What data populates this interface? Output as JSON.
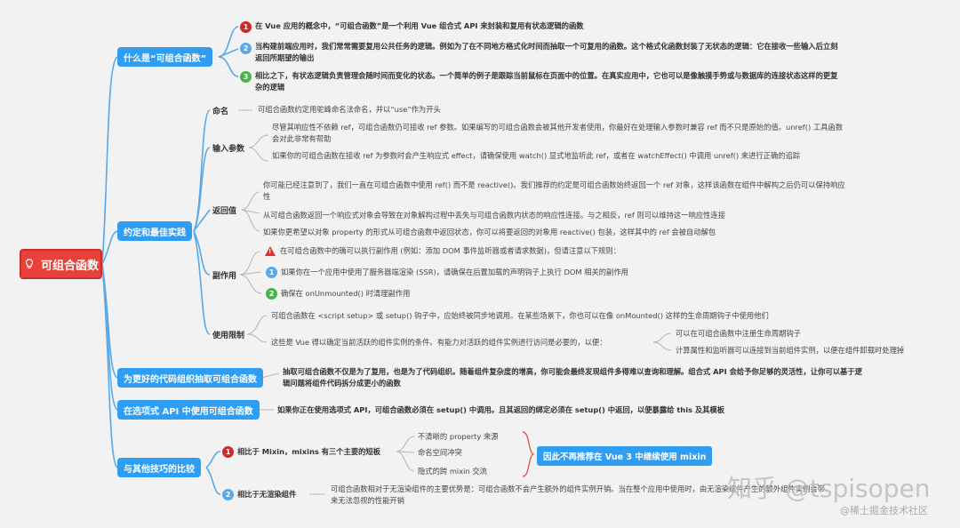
{
  "root": {
    "label": "可组合函数",
    "icon": "lightbulb-icon"
  },
  "branches": {
    "what": {
      "label": "什么是“可组合函数”",
      "items": [
        {
          "num": "1",
          "text": "在 Vue 应用的概念中，“可组合函数”是一个利用 Vue 组合式 API 来封装和复用有状态逻辑的函数"
        },
        {
          "num": "2",
          "text": "当构建前端应用时，我们常常需要复用公共任务的逻辑。例如为了在不同地方格式化时间而抽取一个可复用的函数。这个格式化函数封装了无状态的逻辑：它在接收一些输入后立刻返回所期望的输出"
        },
        {
          "num": "3",
          "text": "相比之下，有状态逻辑负责管理会随时间而变化的状态。一个简单的例子是跟踪当前鼠标在页面中的位置。在真实应用中，它也可以是像触摸手势或与数据库的连接状态这样的更复杂的逻辑"
        }
      ]
    },
    "conventions": {
      "label": "约定和最佳实践",
      "naming": {
        "label": "命名",
        "text": "可组合函数约定用驼峰命名法命名，并以“use”作为开头"
      },
      "input": {
        "label": "输入参数",
        "items": [
          "尽管其响应性不依赖 ref，可组合函数仍可接收 ref 参数。如果编写的可组合函数会被其他开发者使用，你最好在处理输入参数时兼容 ref 而不只是原始的值。unref() 工具函数会对此非常有帮助",
          "如果你的可组合函数在接收 ref 为参数时会产生响应式 effect，请确保使用 watch() 显式地监听此 ref，或者在 watchEffect() 中调用 unref() 来进行正确的追踪"
        ]
      },
      "return": {
        "label": "返回值",
        "items": [
          "你可能已经注意到了，我们一直在可组合函数中使用 ref() 而不是 reactive()。我们推荐的约定是可组合函数始终返回一个 ref 对象，这样该函数在组件中解构之后仍可以保持响应性",
          "从可组合函数返回一个响应式对象会导致在对象解构过程中丢失与可组合函数内状态的响应性连接。与之相反，ref 则可以维持这一响应性连接",
          "如果你更希望以对象 property 的形式从可组合函数中返回状态，你可以将要返回的对象用 reactive() 包装，这样其中的 ref 会被自动解包"
        ]
      },
      "side_effects": {
        "label": "副作用",
        "warning": "在可组合函数中的确可以执行副作用 (例如：添加 DOM 事件监听器或者请求数据)，但请注意以下规则：",
        "items": [
          {
            "num": "1",
            "text": "如果你在一个应用中使用了服务器端渲染 (SSR)，请确保在后置加载的声明钩子上执行 DOM 相关的副作用"
          },
          {
            "num": "2",
            "text": "确保在 onUnmounted() 时清理副作用"
          }
        ]
      },
      "limits": {
        "label": "使用限制",
        "items": [
          "可组合函数在 <script setup> 或 setup() 钩子中，应始终被同步地调用。在某些场景下，你也可以在像 onMounted() 这样的生命周期钩子中使用他们",
          "这些是 Vue 得以确定当前活跃的组件实例的条件。有能力对活跃的组件实例进行访问是必要的，以便："
        ],
        "sub": [
          "可以在可组合函数中注册生命周期钩子",
          "计算属性和监听器可以连接到当前组件实例，以便在组件卸载时处理掉"
        ]
      }
    },
    "extract": {
      "label": "为更好的代码组织抽取可组合函数",
      "text": "抽取可组合函数不仅是为了复用，也是为了代码组织。随着组件复杂度的增高，你可能会最终发现组件多得难以查询和理解。组合式 API 会给予你足够的灵活性，让你可以基于逻辑问题将组件代码拆分成更小的函数"
    },
    "options": {
      "label": "在选项式 API 中使用可组合函数",
      "text": "如果你正在使用选项式 API，可组合函数必须在 setup() 中调用。且其返回的绑定必须在 setup() 中返回，以便暴露给 this 及其模板"
    },
    "compare": {
      "label": "与其他技巧的比较",
      "mixin": {
        "num": "1",
        "label": "相比于 Mixin，mixins 有三个主要的短板",
        "items": [
          "不清晰的 property 来源",
          "命名空间冲突",
          "隐式的跨 mixin 交流"
        ],
        "conclusion": "因此不再推荐在 Vue 3 中继续使用 mixin"
      },
      "renderless": {
        "num": "2",
        "label": "相比于无渲染组件",
        "text": "可组合函数相对于无渲染组件的主要优势是：可组合函数不会产生额外的组件实例开销。当在整个应用中使用时，由无渲染组件产生的额外组件实例会带来无法忽视的性能开销"
      }
    }
  },
  "watermarks": {
    "zhihu": "知乎 @tsp",
    "zhihu_tail": "isopen",
    "juejin": "@稀土掘金技术社区"
  },
  "colors": {
    "root": "#e8413a",
    "branch": "#2f9df2",
    "line": "#5aa8e6"
  }
}
